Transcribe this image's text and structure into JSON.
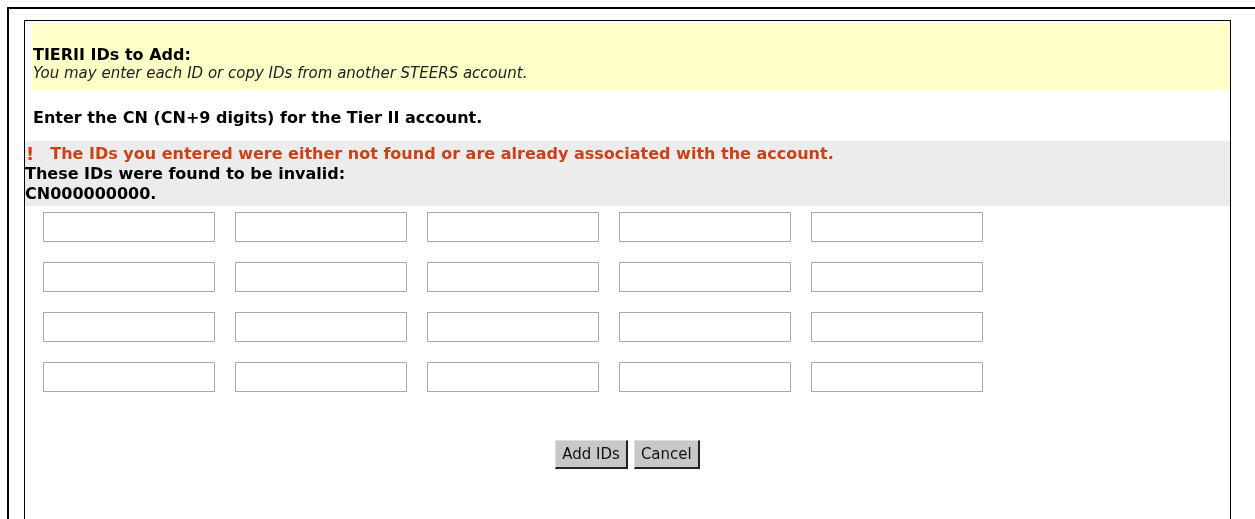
{
  "header": {
    "title": "TIERII IDs to Add:",
    "subtitle": "You may enter each ID or copy IDs from another STEERS account."
  },
  "instruction": "Enter the CN (CN+9 digits) for the Tier II account.",
  "error": {
    "icon": "!",
    "message": "The IDs you entered were either not found or are already associated with the account.",
    "detail": "These IDs were found to be invalid:",
    "invalid_ids": "CN000000000."
  },
  "id_fields": [
    [
      {
        "kind": "text"
      },
      {
        "kind": "text"
      },
      {
        "kind": "text"
      },
      {
        "kind": "text"
      },
      {
        "kind": "text"
      }
    ],
    [
      {
        "kind": "text"
      },
      {
        "kind": "text"
      },
      {
        "kind": "text"
      },
      {
        "kind": "text"
      },
      {
        "kind": "text"
      }
    ],
    [
      {
        "kind": "text"
      },
      {
        "kind": "text"
      },
      {
        "kind": "text"
      },
      {
        "kind": "text"
      },
      {
        "kind": "text"
      }
    ],
    [
      {
        "kind": "text"
      },
      {
        "kind": "text"
      },
      {
        "kind": "text"
      },
      {
        "kind": "text"
      },
      {
        "kind": "text"
      }
    ]
  ],
  "buttons": [
    "Add IDs",
    "Cancel"
  ]
}
